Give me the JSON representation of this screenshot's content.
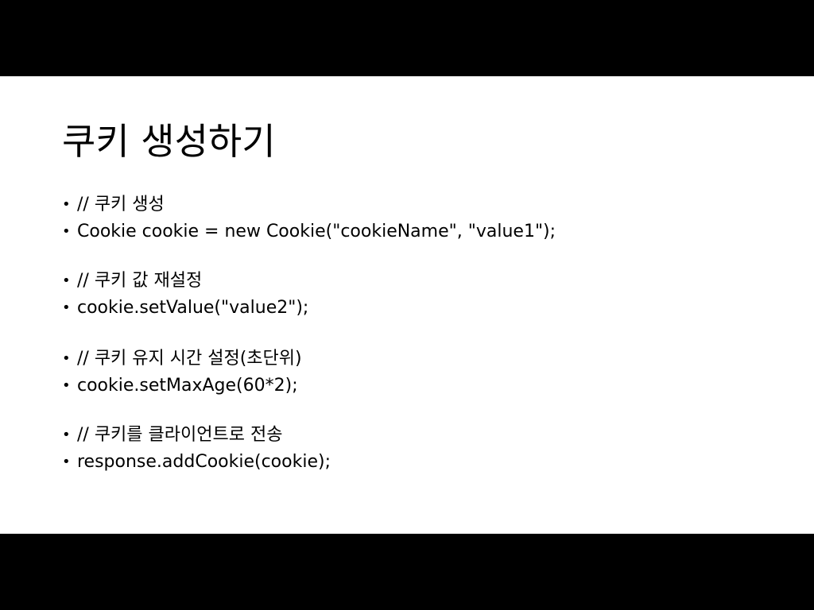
{
  "slide": {
    "title": "쿠키 생성하기",
    "bullet_symbol": "•",
    "bullets": [
      "// 쿠키 생성",
      "Cookie cookie = new Cookie(\"cookieName\", \"value1\");",
      "// 쿠키 값 재설정",
      "cookie.setValue(\"value2\");",
      "// 쿠키 유지 시간 설정(초단위)",
      "cookie.setMaxAge(60*2);",
      "// 쿠키를 클라이언트로 전송",
      "response.addCookie(cookie);"
    ]
  }
}
